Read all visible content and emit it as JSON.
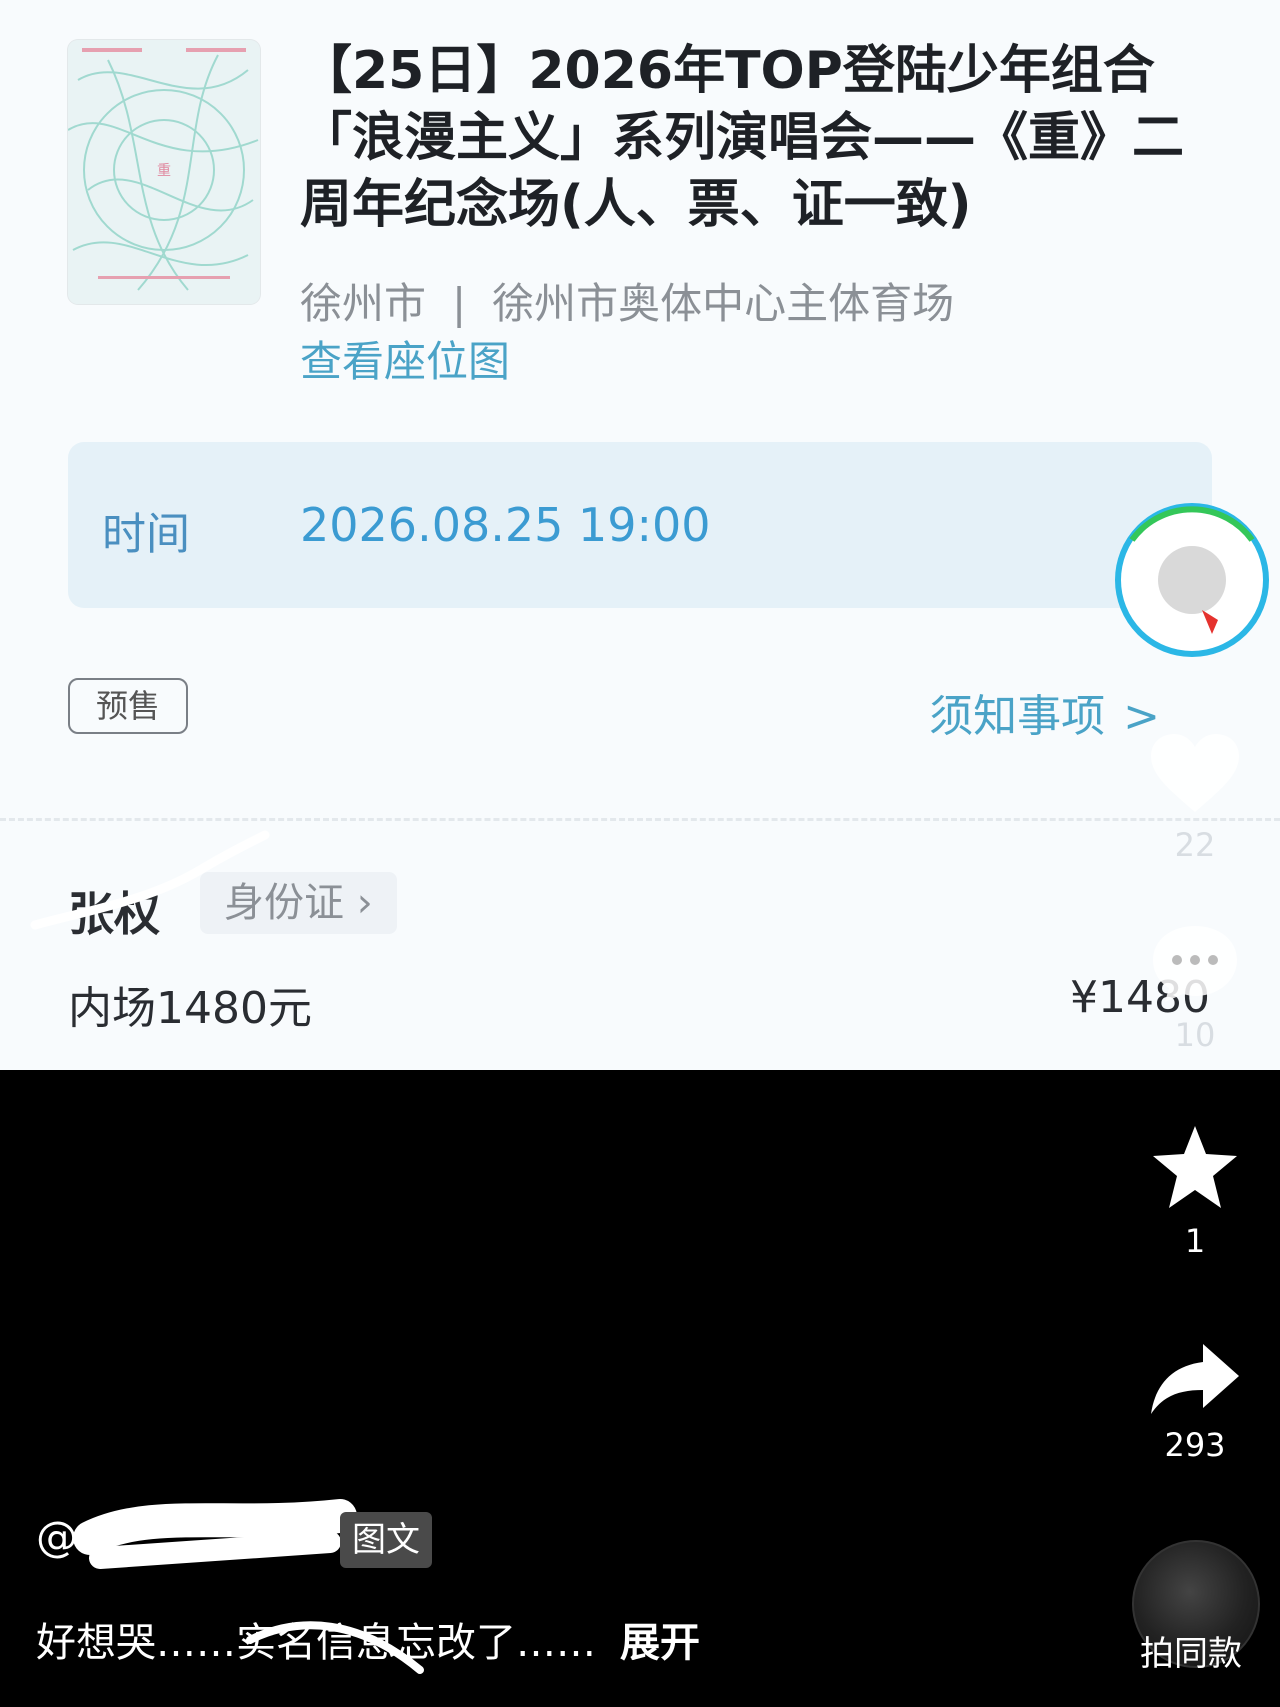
{
  "event": {
    "title": "【25日】2026年TOP登陆少年组合「浪漫主义」系列演唱会——《重》二周年纪念场(人、票、证一致)",
    "city": "徐州市",
    "separator": "|",
    "venue": "徐州市奥体中心主体育场",
    "seat_map_link": "查看座位图"
  },
  "time": {
    "label": "时间",
    "value": "2026.08.25 19:00"
  },
  "presale_badge": "预售",
  "notice_link": "须知事项",
  "notice_chevron": ">",
  "holder": {
    "name": "张权",
    "id_type": "身份证",
    "id_chevron": "›"
  },
  "ticket": {
    "tier": "内场1480元",
    "price": "¥1480"
  },
  "side_actions": {
    "likes": "22",
    "comments": "10",
    "favorites": "1",
    "shares": "293",
    "same_style_label": "拍同款"
  },
  "post": {
    "author": "@",
    "type_badge": "图文",
    "caption": "好想哭……实名信息忘改了……",
    "expand_label": "展开"
  },
  "colors": {
    "link": "#4aa3c7",
    "time_box": "#e5f1f8",
    "page_bg": "#000000"
  }
}
